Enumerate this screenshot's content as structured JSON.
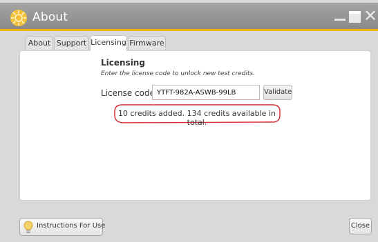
{
  "window": {
    "title": "About",
    "accent_color": "#f0b400",
    "titlebar_color": "#999999",
    "controls": [
      "minimize-icon",
      "maximize-icon",
      "close-icon"
    ],
    "close_glyph": "✕"
  },
  "tabs": [
    {
      "label": "About",
      "active": false
    },
    {
      "label": "Support",
      "active": false
    },
    {
      "label": "Licensing",
      "active": true
    },
    {
      "label": "Firmware",
      "active": false
    }
  ],
  "licensing": {
    "title": "Licensing",
    "description": "Enter the license code to unlock new test credits.",
    "code_label": "License code",
    "code_value": "YTFT-982A-ASWB-99LB",
    "validate_label": "Validate",
    "status_message": "10 credits added. 134 credits available in total.",
    "highlight_color": "#d0262b"
  },
  "footer": {
    "instructions_label": "Instructions For Use",
    "instructions_icon": "lightbulb-icon",
    "close_label": "Close"
  }
}
